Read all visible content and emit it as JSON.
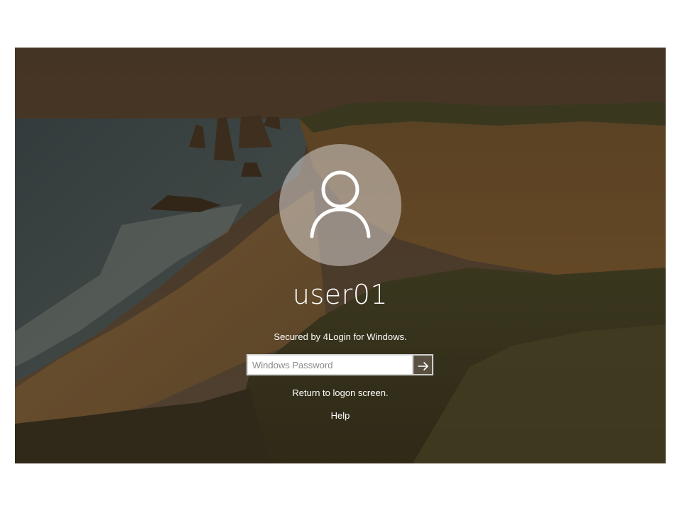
{
  "user": {
    "name": "user01"
  },
  "login": {
    "secured_text": "Secured by 4Login for Windows.",
    "password_placeholder": "Windows Password",
    "submit_icon": "arrow-right-icon",
    "return_link": "Return to logon screen.",
    "help_link": "Help"
  },
  "icons": {
    "avatar": "user-icon"
  },
  "colors": {
    "overlay": "#3a2d1f",
    "text": "#ffffff",
    "input_border": "#d8d8d8"
  }
}
